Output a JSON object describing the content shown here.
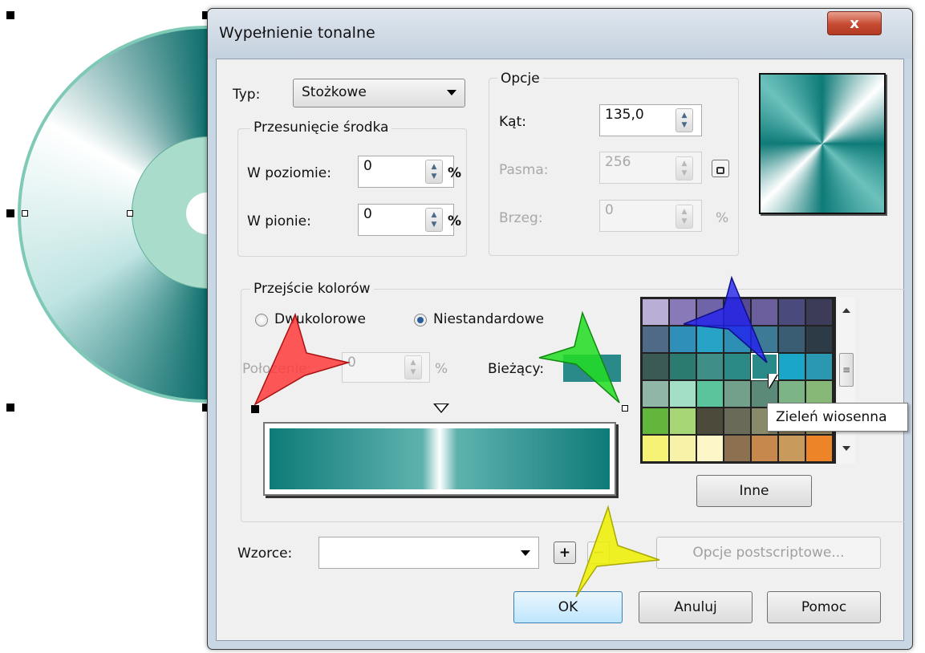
{
  "dialog": {
    "title": "Wypełnienie tonalne",
    "close_glyph": "x"
  },
  "type_row": {
    "label": "Typ:",
    "value": "Stożkowe"
  },
  "center_offset": {
    "title": "Przesunięcie środka",
    "horizontal_label": "W poziomie:",
    "horizontal_value": "0",
    "vertical_label": "W pionie:",
    "vertical_value": "0",
    "unit": "%"
  },
  "options": {
    "title": "Opcje",
    "angle_label": "Kąt:",
    "angle_value": "135,0",
    "steps_label": "Pasma:",
    "steps_value": "256",
    "edge_label": "Brzeg:",
    "edge_value": "0",
    "unit": "%"
  },
  "color_blend": {
    "title": "Przejście kolorów",
    "two_color_label": "Dwukolorowe",
    "custom_label": "Niestandardowe",
    "custom_selected": true,
    "position_label": "Położenie:",
    "position_value": "0",
    "unit": "%",
    "current_label": "Bieżący:",
    "current_color": "#2a8a8a"
  },
  "palette": {
    "colors": [
      [
        "#b9aed6",
        "#8a79b8",
        "#6f64a8",
        "#574a91",
        "#6a5e9c",
        "#4b4a7d",
        "#3c3c59"
      ],
      [
        "#4f6a86",
        "#2f8fb8",
        "#26a3c7",
        "#2c8fb3",
        "#3c7a96",
        "#3b5d74",
        "#2d3b46"
      ],
      [
        "#3b5a56",
        "#2b7b70",
        "#3f8f88",
        "#2b8a86",
        "#2a8a8a",
        "#1aa6c6",
        "#2a98b0"
      ],
      [
        "#8fb6a6",
        "#a3dec6",
        "#5cc49c",
        "#72a08a",
        "#5c8a78",
        "#7cb486",
        "#88b878"
      ],
      [
        "#62b63c",
        "#a6d676",
        "#4c4a3a",
        "#6a6a58",
        "#888a6a",
        "#8a7a56",
        "#a09468"
      ],
      [
        "#f6f276",
        "#f8f2a8",
        "#fcf6c8",
        "#8c7050",
        "#c6884c",
        "#c89a5c",
        "#ee8428"
      ]
    ],
    "hover_tooltip": "Zieleń wiosenna",
    "other_button": "Inne"
  },
  "presets": {
    "label": "Wzorce:",
    "value": "",
    "add_glyph": "+",
    "remove_glyph": "−"
  },
  "buttons": {
    "postscript": "Opcje postscriptowe...",
    "ok": "OK",
    "cancel": "Anuluj",
    "help": "Pomoc"
  },
  "accent_colors": {
    "teal_dark": "#0e7b78",
    "teal_light": "#c8eae3",
    "arrow_red": "#ff3b3b",
    "arrow_green": "#22dd22",
    "arrow_blue": "#2222ee",
    "arrow_yellow": "#eef000"
  }
}
